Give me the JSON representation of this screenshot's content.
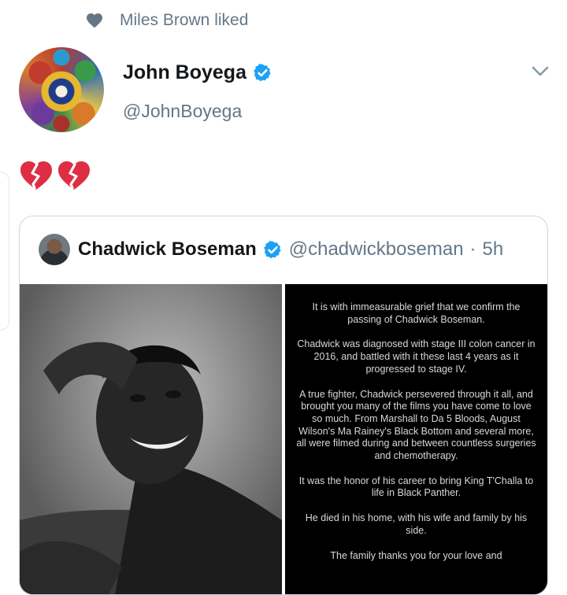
{
  "social_context": {
    "icon": "heart-icon",
    "text": "Miles Brown liked"
  },
  "tweet": {
    "author_name": "John Boyega",
    "author_handle": "@JohnBoyega",
    "verified": true,
    "body": "💔💔",
    "menu_icon": "chevron-down-icon"
  },
  "quoted": {
    "author_name": "Chadwick Boseman",
    "author_handle": "@chadwickboseman",
    "separator": "·",
    "time": "5h",
    "verified": true,
    "statement": [
      "It is with immeasurable grief that we confirm the passing of Chadwick Boseman.",
      "Chadwick was diagnosed with stage III colon cancer in 2016, and battled with it these last 4 years as it progressed to stage IV.",
      "A true fighter, Chadwick persevered through it all, and brought you many of the films you have come to love so much. From Marshall to Da 5 Bloods, August Wilson's Ma Rainey's Black Bottom and several more, all were filmed during and between countless surgeries and chemotherapy.",
      "It was the honor of his career to bring King T'Challa to life in Black Panther.",
      "He died in his home, with his wife and family by his side.",
      "The family thanks you for your love and"
    ]
  },
  "colors": {
    "verified_blue": "#1da1f2",
    "secondary_text": "#657786",
    "border": "#ccd6dd"
  }
}
